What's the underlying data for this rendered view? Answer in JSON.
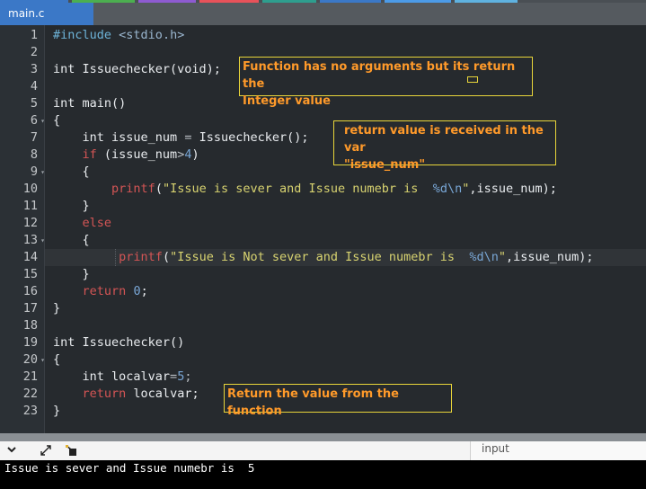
{
  "tab": {
    "title": "main.c"
  },
  "code": {
    "lines": [
      {
        "num": "1",
        "text": "#include <stdio.h>"
      },
      {
        "num": "2",
        "text": ""
      },
      {
        "num": "3",
        "text": "int Issuechecker(void);"
      },
      {
        "num": "4",
        "text": ""
      },
      {
        "num": "5",
        "text": "int main()"
      },
      {
        "num": "6",
        "text": "{"
      },
      {
        "num": "7",
        "text": "    int issue_num = Issuechecker();"
      },
      {
        "num": "8",
        "text": "    if (issue_num>4)"
      },
      {
        "num": "9",
        "text": "    {"
      },
      {
        "num": "10",
        "text": "        printf(\"Issue is sever and Issue numebr is  %d\\n\",issue_num);"
      },
      {
        "num": "11",
        "text": "    }"
      },
      {
        "num": "12",
        "text": "    else"
      },
      {
        "num": "13",
        "text": "    {"
      },
      {
        "num": "14",
        "text": "         printf(\"Issue is Not sever and Issue numebr is  %d\\n\",issue_num);"
      },
      {
        "num": "15",
        "text": "    }"
      },
      {
        "num": "16",
        "text": "    return 0;"
      },
      {
        "num": "17",
        "text": "}"
      },
      {
        "num": "18",
        "text": ""
      },
      {
        "num": "19",
        "text": "int Issuechecker()"
      },
      {
        "num": "20",
        "text": "{"
      },
      {
        "num": "21",
        "text": "    int localvar=5;"
      },
      {
        "num": "22",
        "text": "    return localvar;"
      },
      {
        "num": "23",
        "text": "}"
      }
    ]
  },
  "annotations": {
    "decl_line1": "Function has no arguments but its return the",
    "decl_line2": "Integer value",
    "recv_line1": "return value is received in the var",
    "recv_line2": "\"issue_num\"",
    "ret": "Return the value from the function"
  },
  "output": {
    "input_tab_label": "input",
    "console_text": "Issue is sever and Issue numebr is  5"
  },
  "icons": [
    "chevron-down-icon",
    "expand-icon",
    "share-icon"
  ],
  "colors": {
    "tab_accent": "#3b78c7",
    "annotation_text": "#ff9a2a",
    "annotation_border": "#e8d53a"
  }
}
